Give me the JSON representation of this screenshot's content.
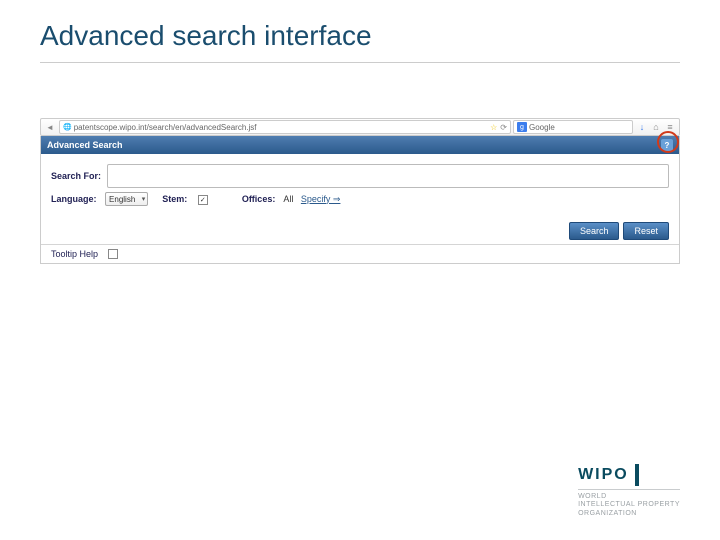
{
  "title": "Advanced search interface",
  "chrome": {
    "url": "patentscope.wipo.int/search/en/advancedSearch.jsf",
    "search_placeholder": "Google"
  },
  "app": {
    "header": "Advanced Search",
    "help_icon": "?",
    "search_for_label": "Search For:",
    "language_label": "Language:",
    "language_value": "English",
    "stem_label": "Stem:",
    "stem_checked": "✓",
    "offices_label": "Offices:",
    "offices_value": "All",
    "specify_link": "Specify ⇒",
    "search_btn": "Search",
    "reset_btn": "Reset",
    "tooltip_label": "Tooltip Help"
  },
  "wipo": {
    "name": "WIPO",
    "line1": "WORLD",
    "line2": "INTELLECTUAL PROPERTY",
    "line3": "ORGANIZATION"
  }
}
